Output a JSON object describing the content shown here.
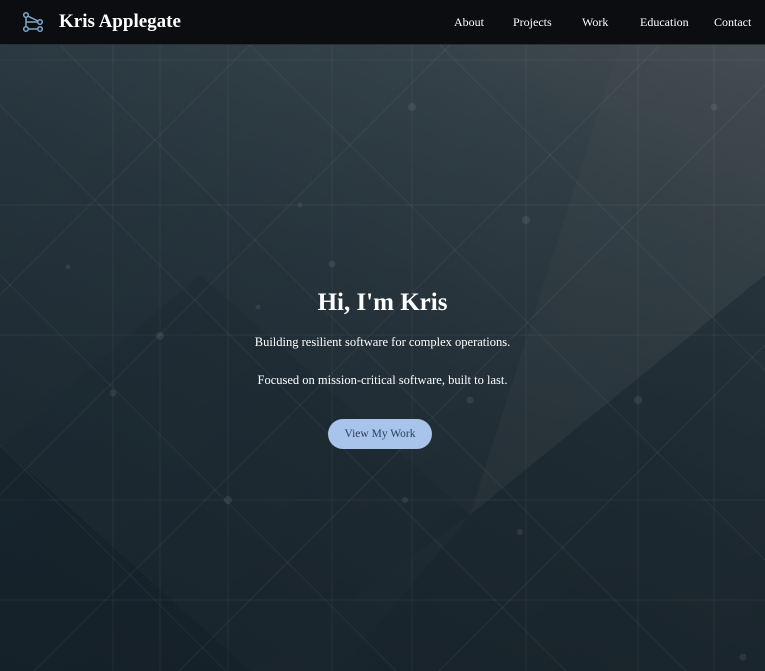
{
  "navbar": {
    "brand_icon": "graph-network-icon",
    "brand_name": "Kris Applegate",
    "links": [
      {
        "label": "About"
      },
      {
        "label": "Projects"
      },
      {
        "label": "Work"
      },
      {
        "label": "Education"
      },
      {
        "label": "Contact"
      }
    ]
  },
  "hero": {
    "title": "Hi, I'm Kris",
    "subtitle": "Building resilient software for complex operations.",
    "tagline": "Focused on mission-critical software, built to last.",
    "cta_label": "View My Work"
  },
  "colors": {
    "navbar_bg": "#0b0d10",
    "hero_bg_dark": "#1a2730",
    "hero_bg_light": "#4a5258",
    "cta_bg": "#a8c4ea",
    "cta_text": "#2b3f5c",
    "brand_icon": "#7fa9c9"
  }
}
